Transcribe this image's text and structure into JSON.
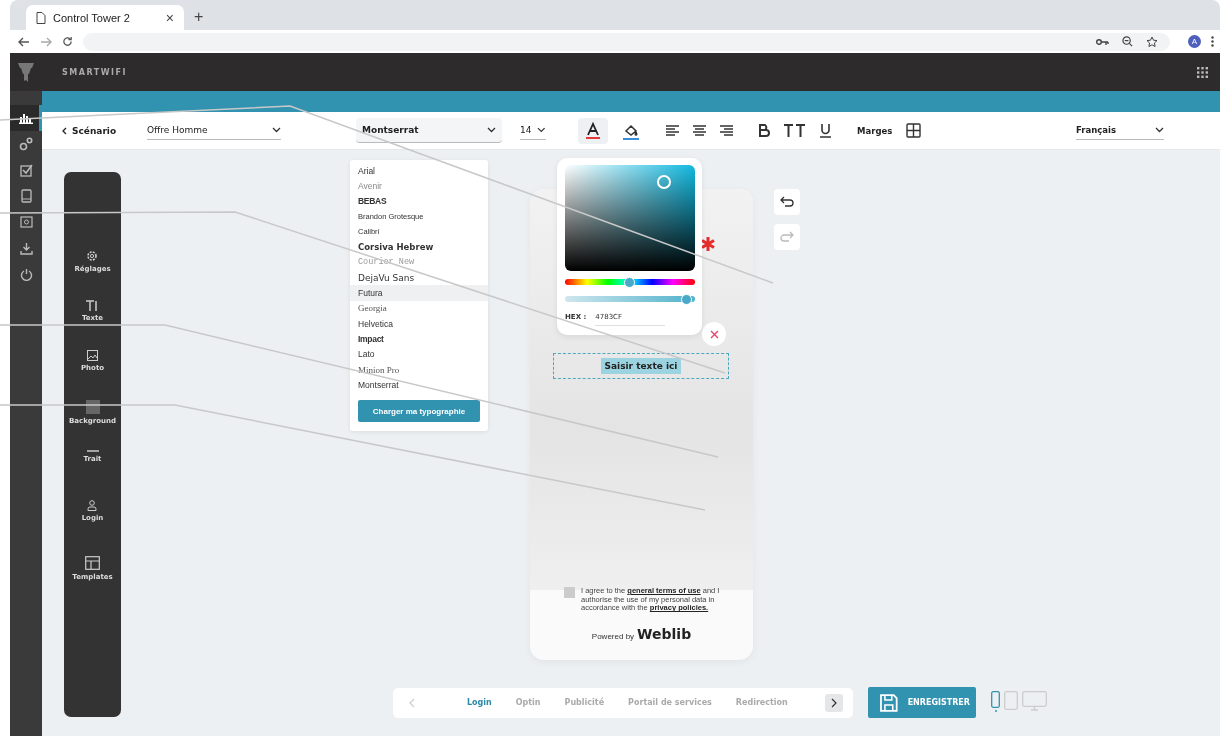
{
  "browser": {
    "tab_title": "Control Tower 2",
    "new_tab": "+",
    "close": "×",
    "avatar": "A"
  },
  "app": {
    "brand": "SMARTWIFI"
  },
  "rail_items": [
    {
      "kind": "chart",
      "selected": true
    },
    {
      "kind": "gears",
      "selected": false
    },
    {
      "kind": "check",
      "selected": false
    },
    {
      "kind": "tablet",
      "selected": false
    },
    {
      "kind": "certificate",
      "selected": false
    },
    {
      "kind": "download",
      "selected": false
    },
    {
      "kind": "power",
      "selected": false
    }
  ],
  "toolbar": {
    "back": "Scénario",
    "scenario": "Offre Homme",
    "font": "Montserrat",
    "size": "14",
    "margins": "Marges",
    "language": "Français"
  },
  "tools": [
    {
      "label": "Réglages",
      "kind": "gear"
    },
    {
      "label": "Texte",
      "kind": "text"
    },
    {
      "label": "Photo",
      "kind": "photo"
    },
    {
      "label": "Background",
      "kind": "pattern"
    },
    {
      "label": "Trait",
      "kind": "line"
    },
    {
      "label": "Login",
      "kind": "user"
    },
    {
      "label": "Templates",
      "kind": "layout"
    }
  ],
  "fonts": [
    {
      "name": "Arial",
      "kind": "sans",
      "hovered": false
    },
    {
      "name": "Avenir",
      "kind": "light",
      "hovered": false
    },
    {
      "name": "BEBAS",
      "kind": "condensed",
      "hovered": false
    },
    {
      "name": "Brandon Grotesque",
      "kind": "small",
      "hovered": false
    },
    {
      "name": "Calibri",
      "kind": "small",
      "hovered": false
    },
    {
      "name": "Corsiva Hebrew",
      "kind": "bold",
      "hovered": false
    },
    {
      "name": "Courier New",
      "kind": "mono",
      "hovered": false
    },
    {
      "name": "DejaVu Sans",
      "kind": "dejavu",
      "hovered": false
    },
    {
      "name": "Futura",
      "kind": "sans",
      "hovered": true
    },
    {
      "name": "Georgia",
      "kind": "serif",
      "hovered": false
    },
    {
      "name": "Helvetica",
      "kind": "sans",
      "hovered": false
    },
    {
      "name": "Impact",
      "kind": "condensed",
      "hovered": false
    },
    {
      "name": "Lato",
      "kind": "sans",
      "hovered": false
    },
    {
      "name": "Minion Pro",
      "kind": "serif",
      "hovered": false
    },
    {
      "name": "Montserrat",
      "kind": "sans",
      "hovered": false
    }
  ],
  "upload_button": "Charger ma typographie",
  "color_picker": {
    "hue": {
      "level": 0.52
    },
    "opacity": {
      "level": 0.96
    },
    "hex_label": "HEX :",
    "hex": "4783CF"
  },
  "phone": {
    "text_box": "Saisir texte ici",
    "consent": [
      {
        "kind": "plain",
        "text": "I agree to the"
      },
      {
        "kind": "link",
        "text": "general terms of use"
      },
      {
        "kind": "plain",
        "text": "and I authorise the use of my personal data in accordance with the"
      },
      {
        "kind": "link",
        "text": "privacy policies."
      }
    ],
    "consent_checked": false,
    "powered_by": "Powered by",
    "brand": "Weblib"
  },
  "steps": [
    {
      "label": "Login",
      "selected": true
    },
    {
      "label": "Optin",
      "selected": false
    },
    {
      "label": "Publicité",
      "selected": false
    },
    {
      "label": "Portail de services",
      "selected": false
    },
    {
      "label": "Redirection",
      "selected": false
    }
  ],
  "save_button": "ENREGISTRER",
  "devices": [
    {
      "kind": "mobile",
      "selected": true
    },
    {
      "kind": "tablet",
      "selected": false
    },
    {
      "kind": "desktop",
      "selected": false
    }
  ]
}
